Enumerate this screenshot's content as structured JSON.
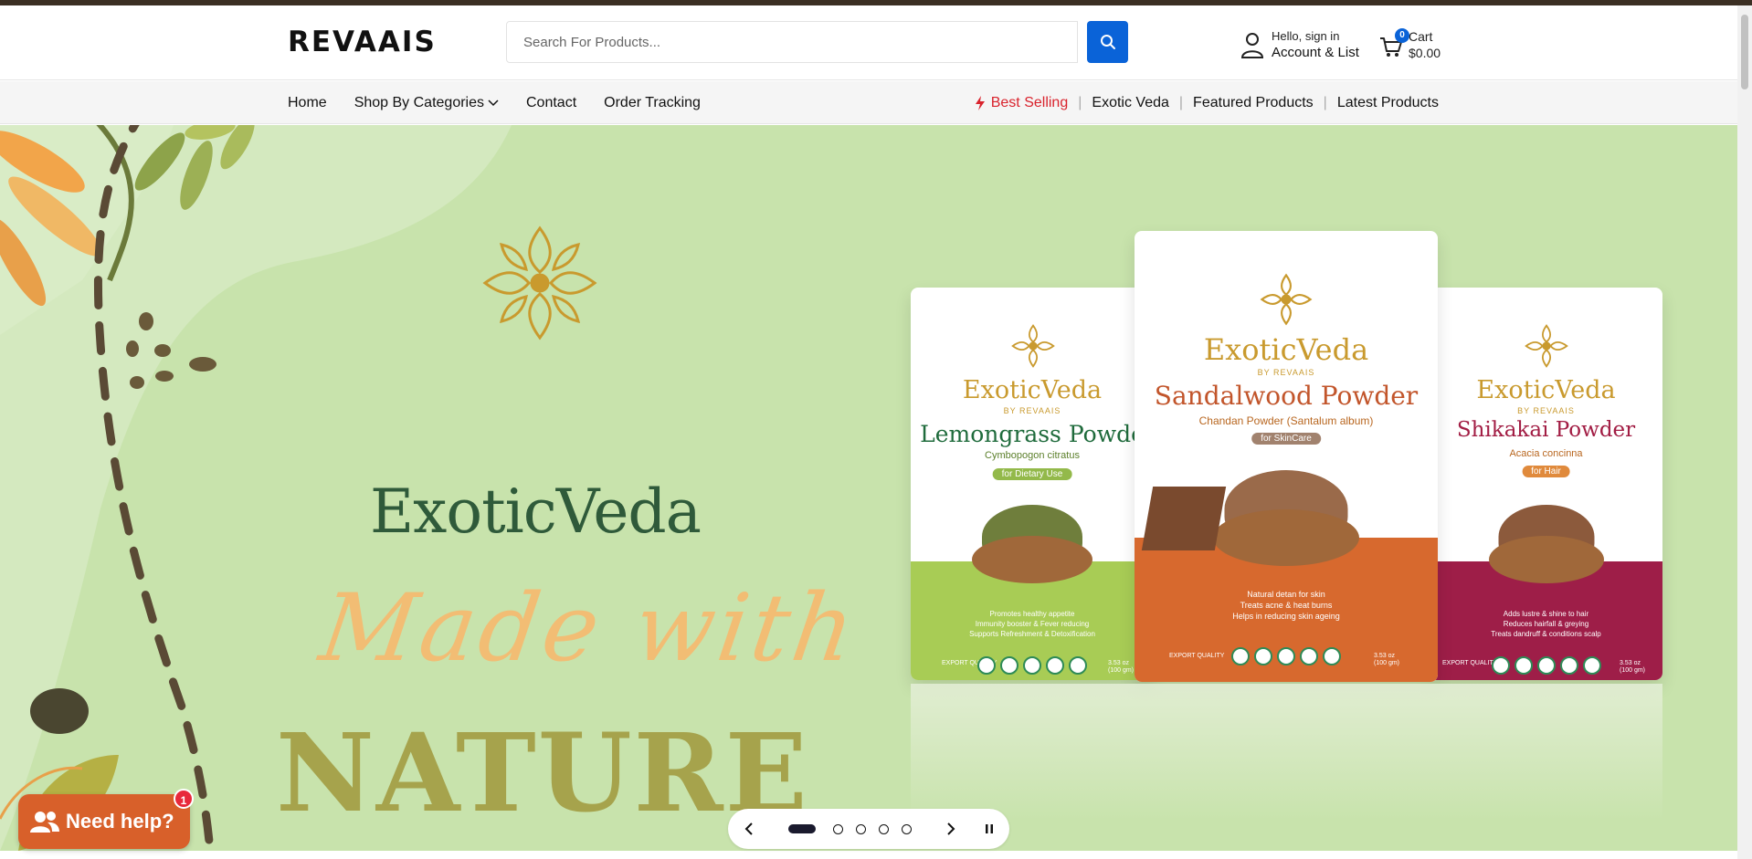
{
  "header": {
    "logo": "REVAAIS",
    "search": {
      "placeholder": "Search For Products..."
    },
    "account": {
      "line1": "Hello, sign in",
      "line2": "Account & List"
    },
    "cart": {
      "label": "Cart",
      "count": "0",
      "total": "$0.00"
    }
  },
  "nav": {
    "left": [
      "Home",
      "Shop By Categories",
      "Contact",
      "Order Tracking"
    ],
    "right": [
      "Best Selling",
      "Exotic Veda",
      "Featured Products",
      "Latest Products"
    ]
  },
  "hero": {
    "brand": "ExoticVeda",
    "headline_script": "Made with",
    "headline_bold": "NATURE",
    "products": [
      {
        "brand": "ExoticVeda",
        "by": "BY REVAAIS",
        "name": "Lemongrass Powde",
        "latin": "Cymbopogon citratus",
        "tag": "for Dietary Use",
        "benefits": [
          "Promotes healthy appetite",
          "Immunity booster & Fever reducing",
          "Supports Refreshment & Detoxification"
        ],
        "quality": "EXPORT QUALITY",
        "weight": "3.53 oz (100 gm)",
        "colors": {
          "band": "#a8cc55",
          "name": "#1f6b3c",
          "latin": "#5b7f2a",
          "tag": "#93b94a",
          "powder": "#6f7e3c"
        }
      },
      {
        "brand": "ExoticVeda",
        "by": "BY REVAAIS",
        "name": "Sandalwood Powder",
        "latin": "Chandan Powder (Santalum album)",
        "tag": "for SkinCare",
        "benefits": [
          "Natural detan for skin",
          "Treats acne & heat burns",
          "Helps in reducing skin ageing"
        ],
        "quality": "EXPORT QUALITY",
        "weight": "3.53 oz (100 gm)",
        "colors": {
          "band": "#d7692e",
          "name": "#c2552b",
          "latin": "#b8661f",
          "tag": "#a1826e",
          "powder": "#9a6a4a"
        }
      },
      {
        "brand": "ExoticVeda",
        "by": "BY REVAAIS",
        "name": "Shikakai Powder",
        "latin": "Acacia concinna",
        "tag": "for Hair",
        "benefits": [
          "Adds lustre & shine to hair",
          "Reduces hairfall & greying",
          "Treats dandruff & conditions scalp"
        ],
        "quality": "EXPORT QUALITY",
        "weight": "3.53 oz (100 gm)",
        "colors": {
          "band": "#9e1e48",
          "name": "#a21d44",
          "latin": "#b8661f",
          "tag": "#e08a3c",
          "powder": "#8c5a3c"
        }
      }
    ],
    "slides": {
      "count": 5,
      "active": 0
    }
  },
  "chat": {
    "label": "Need help?",
    "badge": "1"
  },
  "colors": {
    "accent": "#0a63d8",
    "hero_bg": "#c8e3ac",
    "topstrip": "#3b2f23",
    "best_selling": "#d9232d",
    "chat": "#d8602a"
  }
}
